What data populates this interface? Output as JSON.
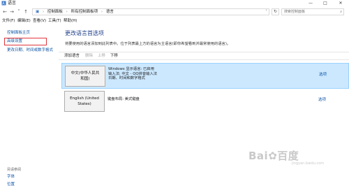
{
  "window": {
    "title": "语言"
  },
  "nav": {
    "breadcrumb": [
      "控制面板",
      "所有控制面板项",
      "语言"
    ],
    "search_placeholder": "搜索控制面板"
  },
  "menu": [
    "文件(F)",
    "编辑(E)",
    "查看(V)",
    "工具(T)",
    "帮助(H)"
  ],
  "sidebar": {
    "links": [
      "控制面板主页",
      "高级设置",
      "更改日期、时间或数字格式"
    ],
    "see_also_label": "另请参阅",
    "see_also_links": [
      "字体",
      "位置"
    ]
  },
  "main": {
    "title": "更改语言首选项",
    "description": "将要使用的语言添加到此列表中。位于列表最上方的语言为主语言(即你希望看到并最常使用的语言)。",
    "toolbar": {
      "add": "添加语言",
      "remove": "删除",
      "move_up": "上移",
      "move_down": "下移"
    },
    "languages": [
      {
        "name_line1": "中文(中华人民共",
        "name_line2": "和国)",
        "info1": "Windows 显示语言: 已启用",
        "info2": "输入法: 中文 - QQ拼音输入法",
        "info3": "日期、时间和数字格式",
        "options": "选项"
      },
      {
        "name_line1": "English (United",
        "name_line2": "States)",
        "info1": "键盘布局: 美式键盘",
        "options": "选项"
      }
    ]
  },
  "watermark": {
    "text": "Bai",
    "text2": "百度",
    "sub": "jingyan.baidu.com"
  }
}
